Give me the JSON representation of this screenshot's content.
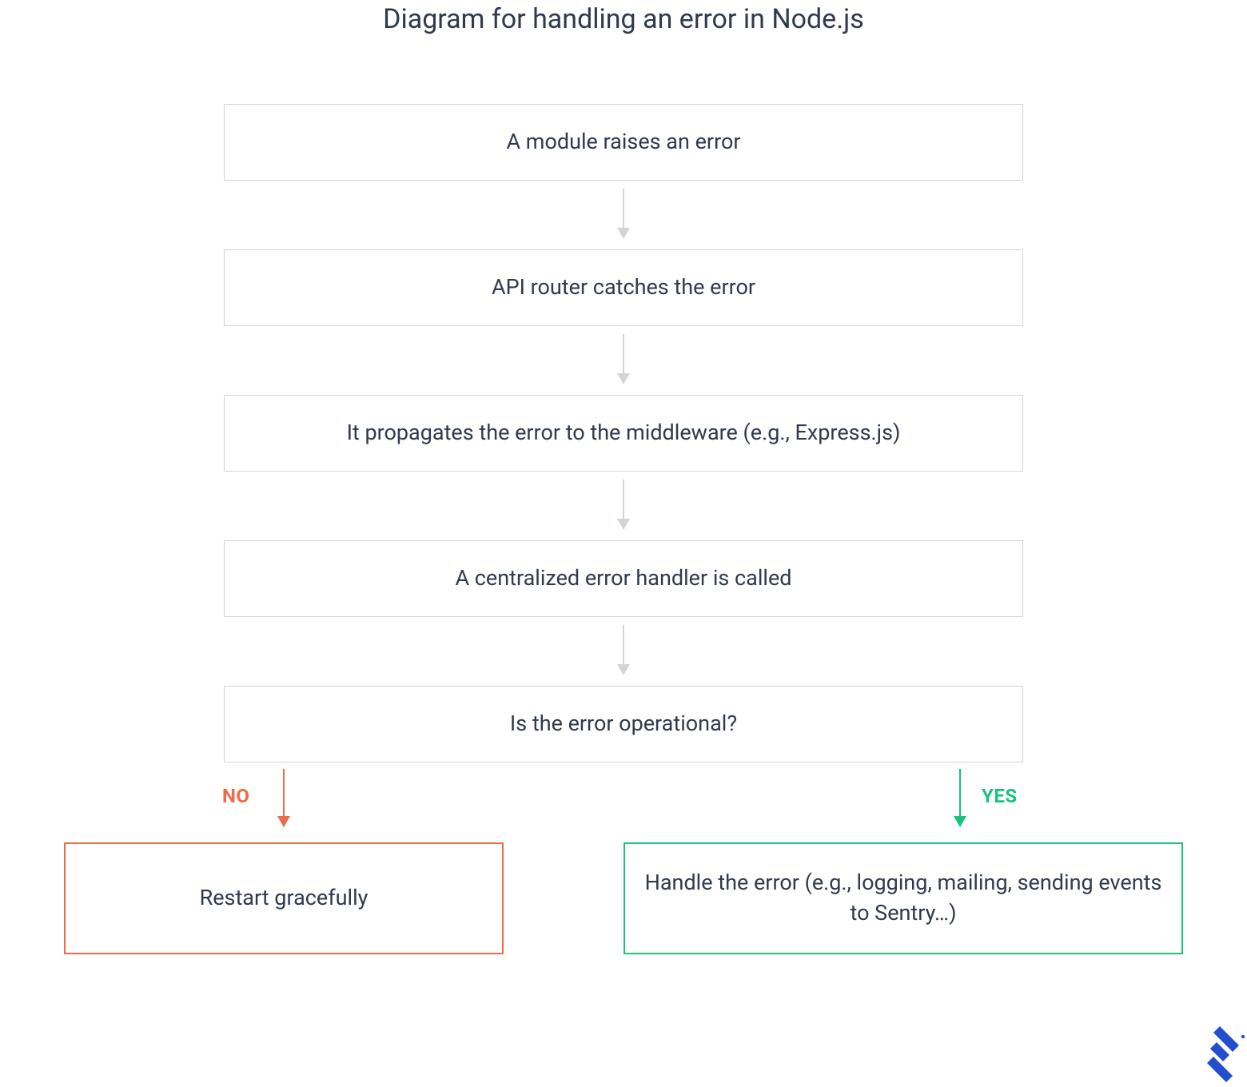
{
  "title": "Diagram for handling an error in Node.js",
  "nodes": {
    "n1": "A module raises an error",
    "n2": "API router catches the error",
    "n3": "It propagates the error to the middleware (e.g., Express.js)",
    "n4": "A centralized error handler is called",
    "n5": "Is the error operational?",
    "no": "Restart gracefully",
    "yes": "Handle the error (e.g., logging, mailing, sending events to Sentry…)"
  },
  "branch": {
    "no_label": "NO",
    "yes_label": "YES"
  },
  "colors": {
    "neutral": "#d1d5db",
    "no": "#ee6b47",
    "yes": "#19c37d",
    "logo": "#204ecf"
  }
}
